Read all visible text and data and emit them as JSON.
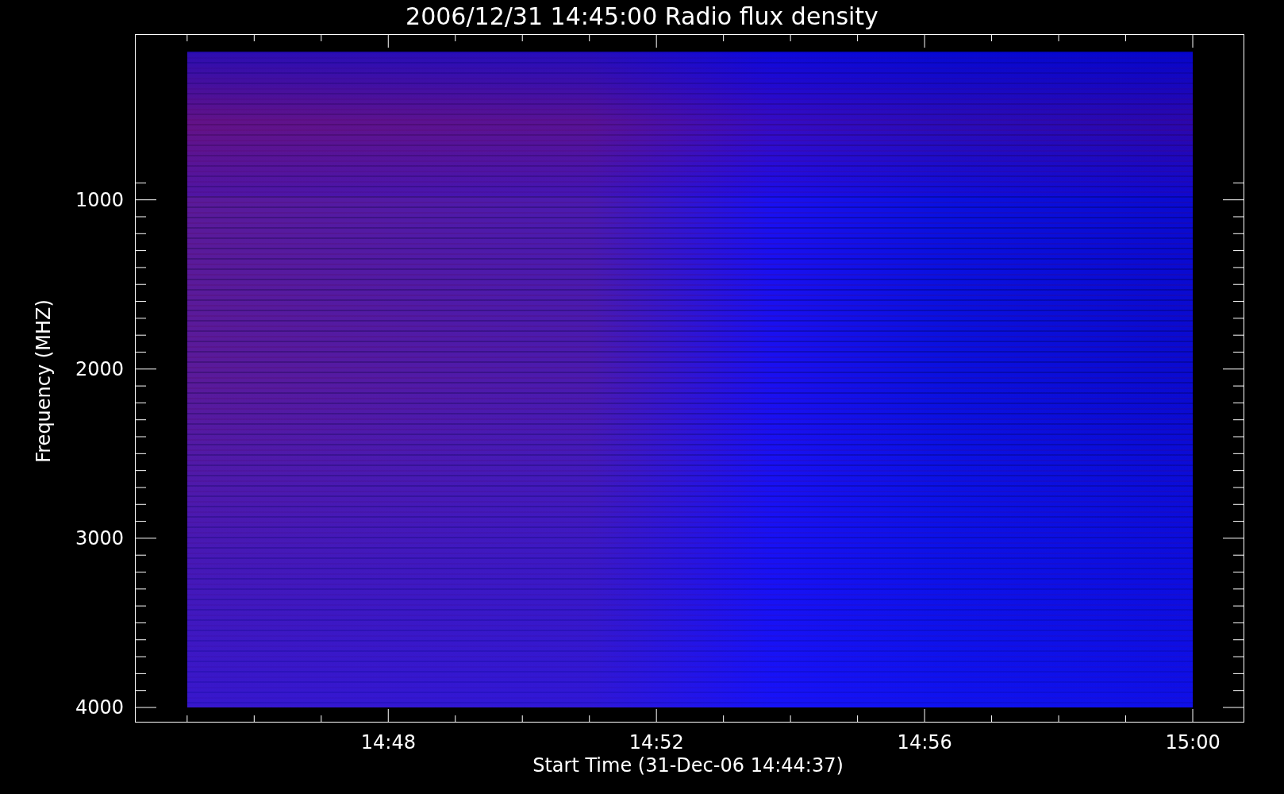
{
  "title": "2006/12/31 14:45:00 Radio flux density",
  "plot": {
    "ylabel": "Frequency (MHZ)",
    "xlabel": "Start Time (31-Dec-06 14:44:37)",
    "yticks": [
      "1000",
      "2000",
      "3000",
      "4000"
    ],
    "xticks": [
      "14:48",
      "14:52",
      "14:56",
      "15:00"
    ]
  }
}
